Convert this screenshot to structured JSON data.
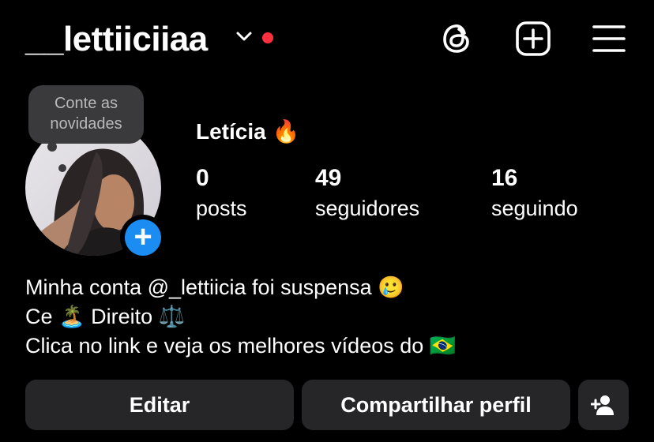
{
  "header": {
    "username": "__lettiiciiaa",
    "icons": [
      "chevron-down-icon",
      "notification-dot",
      "threads-icon",
      "new-post-icon",
      "menu-icon"
    ],
    "notification_color": "#ff3040"
  },
  "profile": {
    "note_bubble": [
      "Conte as",
      "novidades"
    ],
    "display_name": "Letícia",
    "name_emoji": "🔥",
    "stats": [
      {
        "value": "0",
        "label": "posts"
      },
      {
        "value": "49",
        "label": "seguidores"
      },
      {
        "value": "16",
        "label": "seguindo"
      }
    ],
    "add_story_color": "#1b8cf2"
  },
  "bio": {
    "line1_text": "Minha conta @_lettiicia foi suspensa",
    "line1_emoji": "🥲",
    "line2_a": "Ce",
    "line2_emoji1": "🏝️",
    "line2_b": "Direito",
    "line2_emoji2": "⚖️",
    "line3_text": "Clica no link e veja os melhores vídeos do",
    "line3_emoji": "🇧🇷"
  },
  "actions": {
    "edit_label": "Editar",
    "share_label": "Compartilhar perfil",
    "add_user_icon": "add-person-icon"
  }
}
